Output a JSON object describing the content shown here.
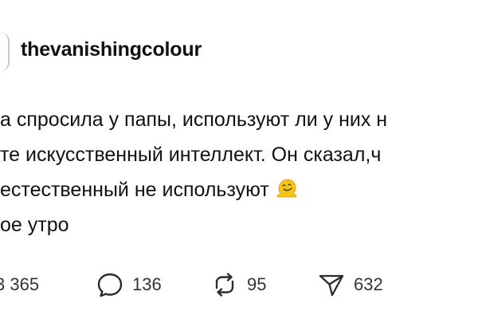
{
  "post": {
    "username": "thevanishingcolour",
    "text_lines": [
      "а спросила у папы, используют ли у них н",
      "те искусственный интеллект. Он сказал,ч",
      " естественный не используют",
      "ое утро"
    ],
    "emoji": "melting-face-emoji"
  },
  "actions": {
    "likes": "3 365",
    "replies": "136",
    "reposts": "95",
    "shares": "632"
  },
  "icons": {
    "reply": "speech-bubble-icon",
    "repost": "repost-arrows-icon",
    "share": "paper-plane-icon"
  },
  "colors": {
    "text": "#121212",
    "muted": "#333333",
    "emoji": "#f5c518"
  }
}
